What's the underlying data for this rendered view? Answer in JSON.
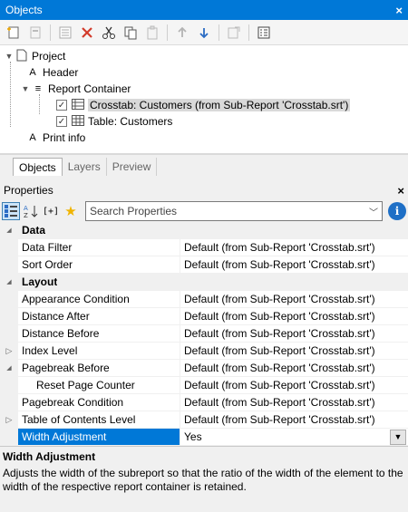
{
  "window": {
    "title": "Objects",
    "close": "×"
  },
  "tree": {
    "project": "Project",
    "header": "Header",
    "report_container": "Report Container",
    "crosstab": "Crosstab: Customers (from Sub-Report 'Crosstab.srt')",
    "table": "Table: Customers",
    "print_info": "Print info"
  },
  "tabs": [
    "Objects",
    "Layers",
    "Preview"
  ],
  "properties": {
    "title": "Properties",
    "close": "×",
    "search_placeholder": "Search Properties",
    "info": "i",
    "rows": [
      {
        "type": "category",
        "name": "Data"
      },
      {
        "type": "prop",
        "name": "Data Filter",
        "value": "Default (from Sub-Report 'Crosstab.srt')"
      },
      {
        "type": "prop",
        "name": "Sort Order",
        "value": "Default (from Sub-Report 'Crosstab.srt')"
      },
      {
        "type": "category",
        "name": "Layout"
      },
      {
        "type": "prop",
        "name": "Appearance Condition",
        "value": "Default (from Sub-Report 'Crosstab.srt')"
      },
      {
        "type": "prop",
        "name": "Distance After",
        "value": "Default (from Sub-Report 'Crosstab.srt')"
      },
      {
        "type": "prop",
        "name": "Distance Before",
        "value": "Default (from Sub-Report 'Crosstab.srt')"
      },
      {
        "type": "prop",
        "name": "Index Level",
        "value": "Default (from Sub-Report 'Crosstab.srt')",
        "expander": "collapsed"
      },
      {
        "type": "prop",
        "name": "Pagebreak Before",
        "value": "Default (from Sub-Report 'Crosstab.srt')",
        "expander": "expanded"
      },
      {
        "type": "prop",
        "name": "Reset Page Counter",
        "value": "Default (from Sub-Report 'Crosstab.srt')",
        "indent": true
      },
      {
        "type": "prop",
        "name": "Pagebreak Condition",
        "value": "Default (from Sub-Report 'Crosstab.srt')"
      },
      {
        "type": "prop",
        "name": "Table of Contents Level",
        "value": "Default (from Sub-Report 'Crosstab.srt')",
        "expander": "collapsed"
      },
      {
        "type": "prop",
        "name": "Width Adjustment",
        "value": "Yes",
        "selected": true
      }
    ]
  },
  "description": {
    "title": "Width Adjustment",
    "body": "Adjusts the width of the subreport so that the ratio of the width of the element to the width of the respective report container is retained."
  },
  "colors": {
    "accent": "#0078d7",
    "selection": "#0078d7"
  }
}
